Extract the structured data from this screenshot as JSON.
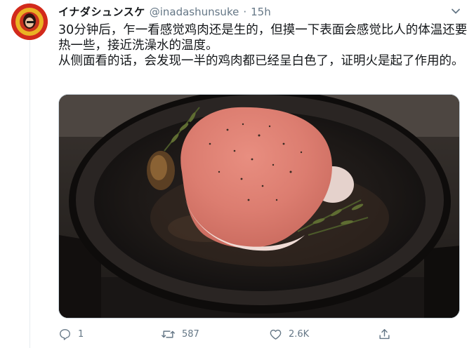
{
  "author": {
    "display_name": "イナダシュンスケ",
    "handle": "@inadashunsuke",
    "separator": "·",
    "time": "15h"
  },
  "tweet": {
    "line1": "30分钟后，乍一看感觉鸡肉还是生的，但摸一下表面会感觉比人的体温还要热一些，接近洗澡水的温度。",
    "line2": "从侧面看的话，会发现一半的鸡肉都已经呈白色了，证明火是起了作用的。"
  },
  "actions": {
    "reply_count": "1",
    "retweet_count": "587",
    "like_count": "2.6K",
    "share_label": ""
  },
  "icons": {
    "reply": "reply-icon",
    "retweet": "retweet-icon",
    "like": "heart-icon",
    "share": "share-icon",
    "menu": "chevron-down-icon"
  },
  "colors": {
    "text": "#14171a",
    "secondary": "#657786",
    "border": "#e6ecf0"
  }
}
